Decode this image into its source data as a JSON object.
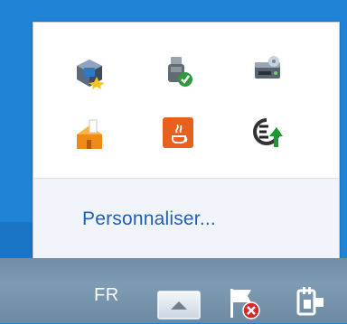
{
  "overflow_panel": {
    "icons": [
      {
        "name": "virtualbox-icon"
      },
      {
        "name": "usb-safely-remove-icon"
      },
      {
        "name": "removable-drive-icon"
      },
      {
        "name": "installer-service-icon"
      },
      {
        "name": "java-icon"
      },
      {
        "name": "sync-update-icon"
      }
    ],
    "customize_link": "Personnaliser..."
  },
  "taskbar": {
    "language": "FR",
    "show_hidden_icons_button": {
      "icon": "chevron-up-icon"
    },
    "action_center": {
      "icon": "flag-error-icon"
    },
    "power": {
      "icon": "power-plug-icon"
    }
  },
  "colors": {
    "desktop_blue": "#1f83d6",
    "link_blue": "#1d5fb0",
    "taskbar": "#7d9bb3"
  }
}
